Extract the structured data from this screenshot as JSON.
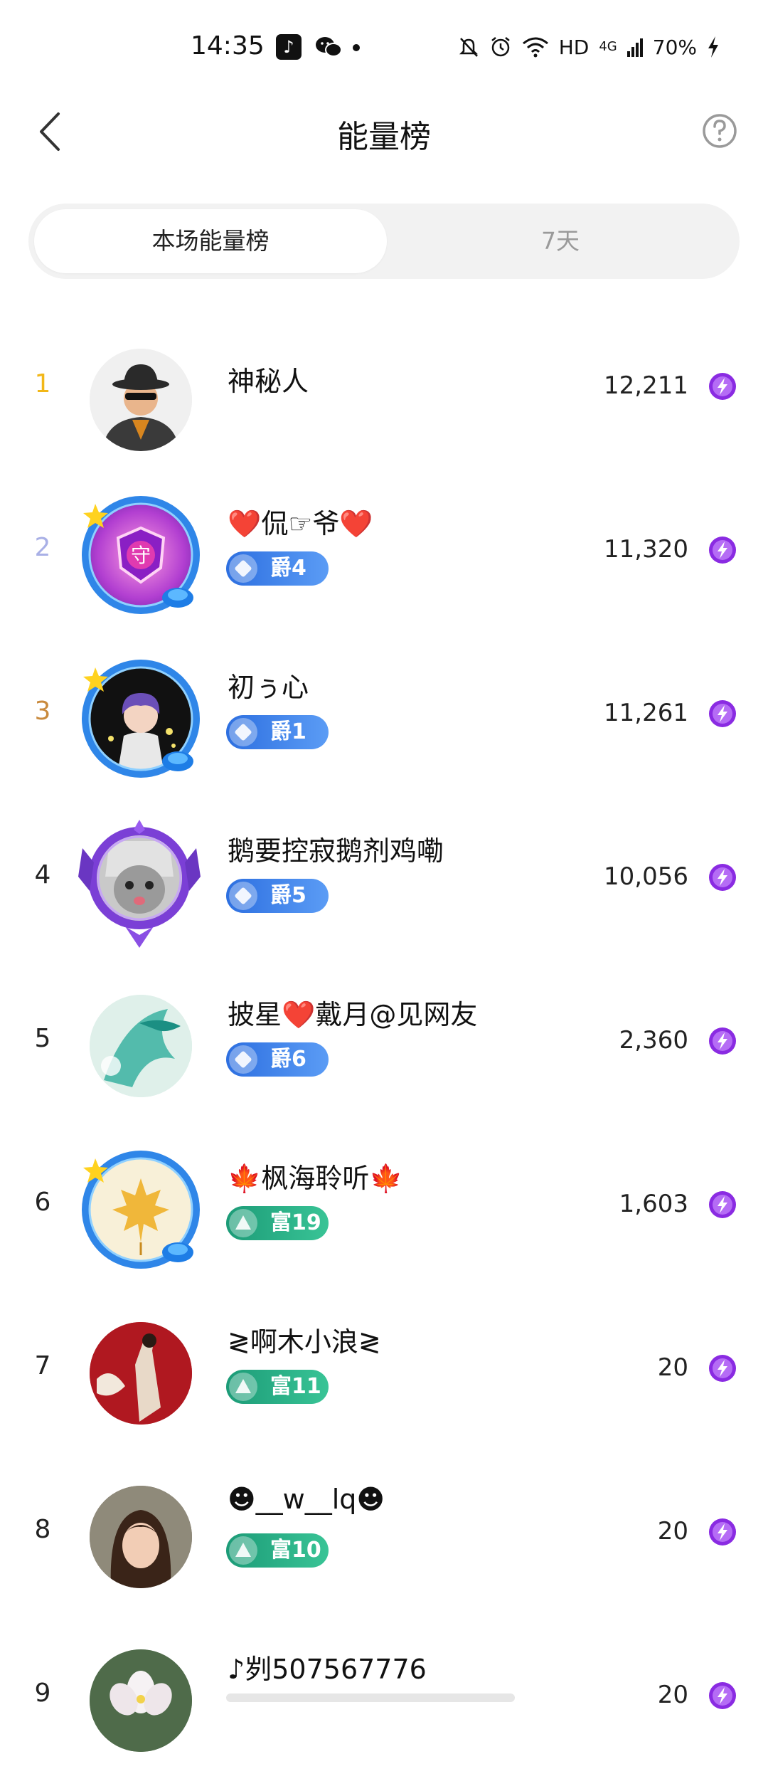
{
  "status_bar": {
    "time": "14:35",
    "network": "HD",
    "signal": "4G",
    "battery": "70%"
  },
  "header": {
    "title": "能量榜",
    "back_icon": "chevron-left-icon",
    "help_icon": "help-circle-icon"
  },
  "tabs": [
    {
      "label": "本场能量榜",
      "active": true
    },
    {
      "label": "7天",
      "active": false
    }
  ],
  "colors": {
    "rank1": "#f2b718",
    "rank2": "#a9b0e6",
    "rank3": "#c98a3d",
    "energy": "#8a2be2",
    "tab_bg": "#f2f2f2"
  },
  "ranking": [
    {
      "rank": "1",
      "name": "神秘人",
      "badge": null,
      "score": "12,211"
    },
    {
      "rank": "2",
      "name": "❤️侃☞爷❤️",
      "badge": {
        "type": "blue",
        "label": "爵4"
      },
      "score": "11,320"
    },
    {
      "rank": "3",
      "name": "初ぅ心",
      "badge": {
        "type": "blue",
        "label": "爵1"
      },
      "score": "11,261"
    },
    {
      "rank": "4",
      "name": "鹅要控寂鹅剂鸡嘞",
      "badge": {
        "type": "blue",
        "label": "爵5"
      },
      "score": "10,056"
    },
    {
      "rank": "5",
      "name": "披星❤️戴月@见网友",
      "badge": {
        "type": "blue",
        "label": "爵6"
      },
      "score": "2,360"
    },
    {
      "rank": "6",
      "name": "🍁枫海聆听🍁",
      "badge": {
        "type": "green",
        "label": "富19"
      },
      "score": "1,603"
    },
    {
      "rank": "7",
      "name": "≷啊木小浪≷",
      "badge": {
        "type": "green",
        "label": "富11"
      },
      "score": "20"
    },
    {
      "rank": "8",
      "name": "☻__w__lq☻",
      "badge": {
        "type": "green",
        "label": "富10"
      },
      "score": "20"
    },
    {
      "rank": "9",
      "name": "♪刿507567776",
      "badge": null,
      "score": "20"
    }
  ]
}
